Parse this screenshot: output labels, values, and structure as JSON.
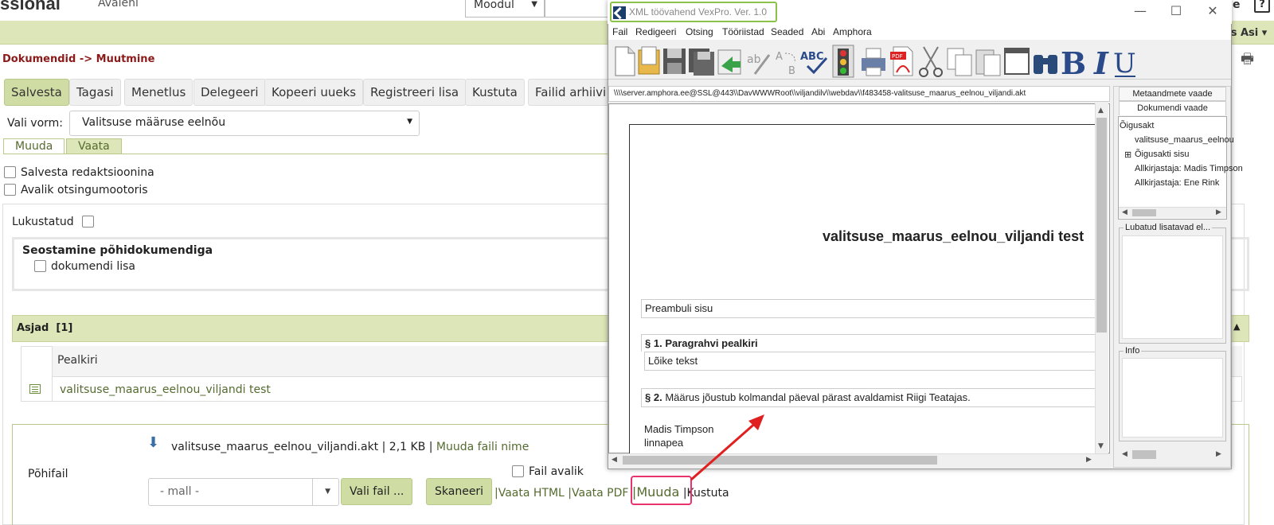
{
  "app": {
    "brand": "ssional",
    "home": "Avalehl",
    "module_select": "Moodul",
    "user_menu": "lus Asi ▾",
    "top_right": "ue",
    "help": "?"
  },
  "breadcrumb": "Dokumendid -> Muutmine",
  "actions": {
    "save": "Salvesta",
    "back": "Tagasi",
    "procedure": "Menetlus",
    "delegate": "Delegeeri",
    "copy": "Kopeeri uueks",
    "register": "Registreeri lisa",
    "delete": "Kustuta",
    "archive": "Failid arhiivi"
  },
  "form": {
    "label": "Vali vorm:",
    "selected": "Valitsuse määruse eelnõu"
  },
  "tabs": {
    "edit": "Muuda",
    "view": "Vaata"
  },
  "options": {
    "save_redaction": "Salvesta redaktsioonina",
    "public_search": "Avalik otsingumootoris",
    "locked": "Lukustatud"
  },
  "linking": {
    "title": "Seostamine põhidokumendiga",
    "attachment": "dokumendi lisa"
  },
  "cases": {
    "title": "Asjad",
    "count": "[1]",
    "column": "Pealkiri",
    "rows": [
      "valitsuse_maarus_eelnou_viljandi test"
    ]
  },
  "file": {
    "label": "Põhifail",
    "name": "valitsuse_maarus_eelnou_viljandi.akt",
    "size": "2,1 KB",
    "rename": "Muuda faili nime",
    "public": "Fail avalik",
    "template": "- mall -",
    "choose": "Vali fail ...",
    "scan": "Skaneeri",
    "view_html": "|Vaata HTML",
    "view_pdf": "|Vaata PDF",
    "edit": "|Muuda",
    "delete_sep": "|",
    "delete": "Kustuta"
  },
  "editor": {
    "title": "XML töövahend VexPro. Ver. 1.0",
    "menu": [
      "Fail",
      "Redigeeri",
      "Otsing",
      "Tööriistad",
      "Seaded",
      "Abi",
      "Amphora"
    ],
    "path": "\\\\\\\\server.amphora.ee@SSL@443\\\\DavWWWRoot\\\\viljandilv\\\\webdav\\\\f483458-valitsuse_maarus_eelnou_viljandi.akt",
    "doc_title": "valitsuse_maarus_eelnou_viljandi test",
    "preamble": "Preambuli sisu",
    "par1_num": "§ 1.",
    "par1_title": "Paragrahvi pealkiri",
    "par1_text": "Lõike tekst",
    "par2_num": "§ 2.",
    "par2_text": "Määrus jõustub kolmandal päeval pärast avaldamist Riigi Teatajas.",
    "signer_name": "Madis  Timpson",
    "signer_role": "linnapea",
    "side_tabs": [
      "Metaandmete vaade",
      "Dokumendi vaade"
    ],
    "tree": {
      "root": "Õigusakt",
      "items": [
        "valitsuse_maarus_eelnou",
        "Õigusakti sisu",
        "Allkirjastaja: Madis Timpson",
        "Allkirjastaja: Ene Rink"
      ]
    },
    "allowed_label": "Lubatud lisatavad el...",
    "info_label": "Info"
  },
  "colors": {
    "accent_green": "#dde6b8",
    "breadcrumb_red": "#8b1a1a",
    "highlight_pink": "#e8336d",
    "title_highlight": "#8bc34a",
    "arrow_red": "#e02020"
  }
}
